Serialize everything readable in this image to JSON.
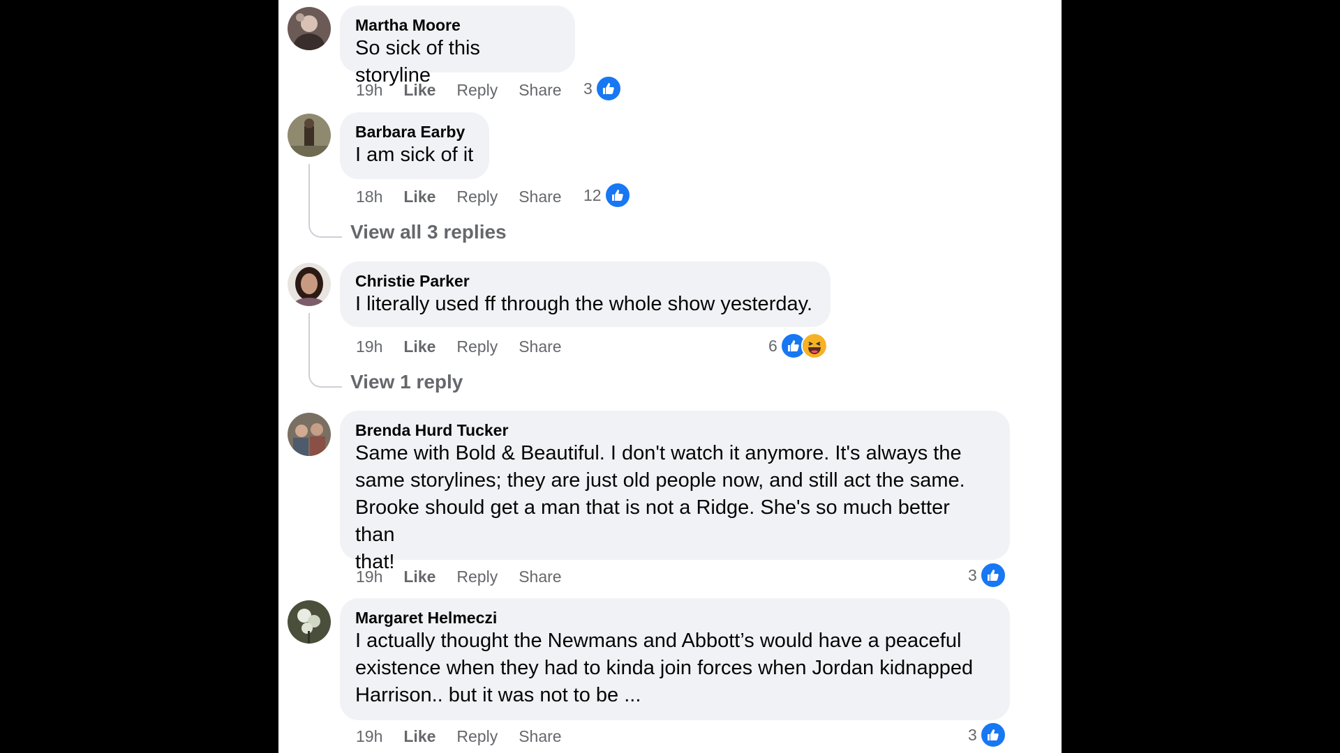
{
  "comments": [
    {
      "author": "Martha Moore",
      "text": [
        "So sick of this storyline"
      ],
      "time": "19h",
      "like_label": "Like",
      "reply_label": "Reply",
      "share_label": "Share",
      "reaction_count": "3",
      "reactions": [
        "like-icon"
      ]
    },
    {
      "author": "Barbara Earby",
      "text": [
        "I am sick of it"
      ],
      "time": "18h",
      "like_label": "Like",
      "reply_label": "Reply",
      "share_label": "Share",
      "reaction_count": "12",
      "reactions": [
        "like-icon"
      ],
      "view_replies": "View all 3 replies"
    },
    {
      "author": "Christie Parker",
      "text": [
        "I literally used ff through the whole show yesterday."
      ],
      "time": "19h",
      "like_label": "Like",
      "reply_label": "Reply",
      "share_label": "Share",
      "reaction_count": "6",
      "reactions": [
        "like-icon",
        "haha-icon"
      ],
      "view_replies": "View 1 reply"
    },
    {
      "author": "Brenda Hurd Tucker",
      "text": [
        "Same with Bold & Beautiful. I don't watch it anymore. It's always the",
        "same storylines; they are just old people now, and still act the same.",
        "Brooke should get a man that is not a Ridge. She's so much better than",
        "that!"
      ],
      "time": "19h",
      "like_label": "Like",
      "reply_label": "Reply",
      "share_label": "Share",
      "reaction_count": "3",
      "reactions": [
        "like-icon"
      ]
    },
    {
      "author": "Margaret Helmeczi",
      "text": [
        "I actually thought the Newmans and Abbott’s would have a peaceful",
        "existence when they had to kinda join forces when Jordan kidnapped",
        "Harrison.. but it was not to be ..."
      ],
      "time": "19h",
      "like_label": "Like",
      "reply_label": "Reply",
      "share_label": "Share",
      "reaction_count": "3",
      "reactions": [
        "like-icon"
      ]
    }
  ],
  "colors": {
    "background": "#000000",
    "panel": "#ffffff",
    "bubble": "#f0f2f5",
    "secondary_text": "#65676b",
    "like_blue": "#1877f2"
  }
}
